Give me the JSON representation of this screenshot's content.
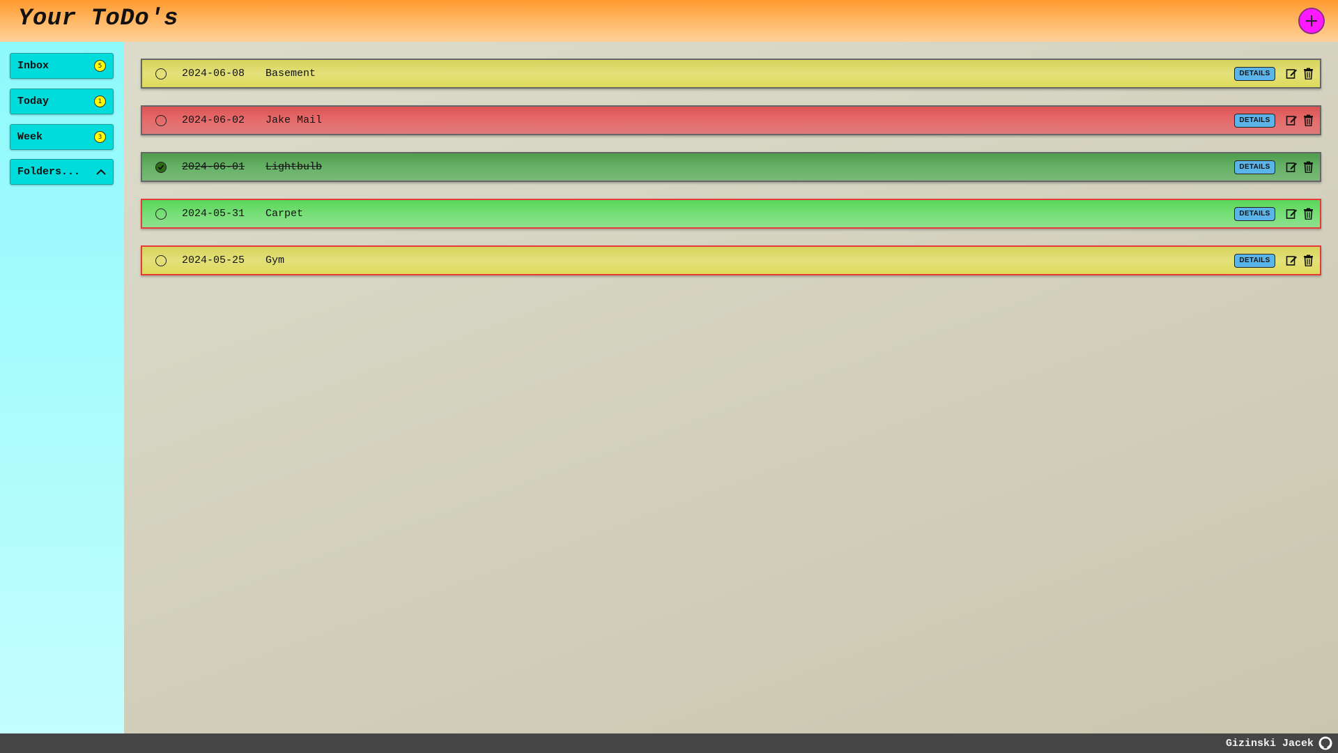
{
  "header": {
    "title": "Your ToDo's",
    "add_icon": "plus-icon"
  },
  "sidebar": {
    "items": [
      {
        "label": "Inbox",
        "count": "5"
      },
      {
        "label": "Today",
        "count": "1"
      },
      {
        "label": "Week",
        "count": "3"
      }
    ],
    "folders": {
      "label": "Folders...",
      "icon": "chevron-up-icon"
    }
  },
  "todos": [
    {
      "date": "2024-06-08",
      "title": "Basement",
      "done": false,
      "color": "#dedb5a",
      "details_label": "DETAILS"
    },
    {
      "date": "2024-06-02",
      "title": "Jake Mail",
      "done": false,
      "color": "#e06060",
      "details_label": "DETAILS"
    },
    {
      "date": "2024-06-01",
      "title": "Lightbulb",
      "done": true,
      "color": "#5ea85e",
      "details_label": "DETAILS"
    },
    {
      "date": "2024-05-31",
      "title": "Carpet",
      "done": false,
      "color": "#6edc6e",
      "details_label": "DETAILS"
    },
    {
      "date": "2024-05-25",
      "title": "Gym",
      "done": false,
      "color": "#dedb5a",
      "details_label": "DETAILS"
    }
  ],
  "footer": {
    "author": "Gizinski Jacek",
    "icon": "github-icon"
  }
}
